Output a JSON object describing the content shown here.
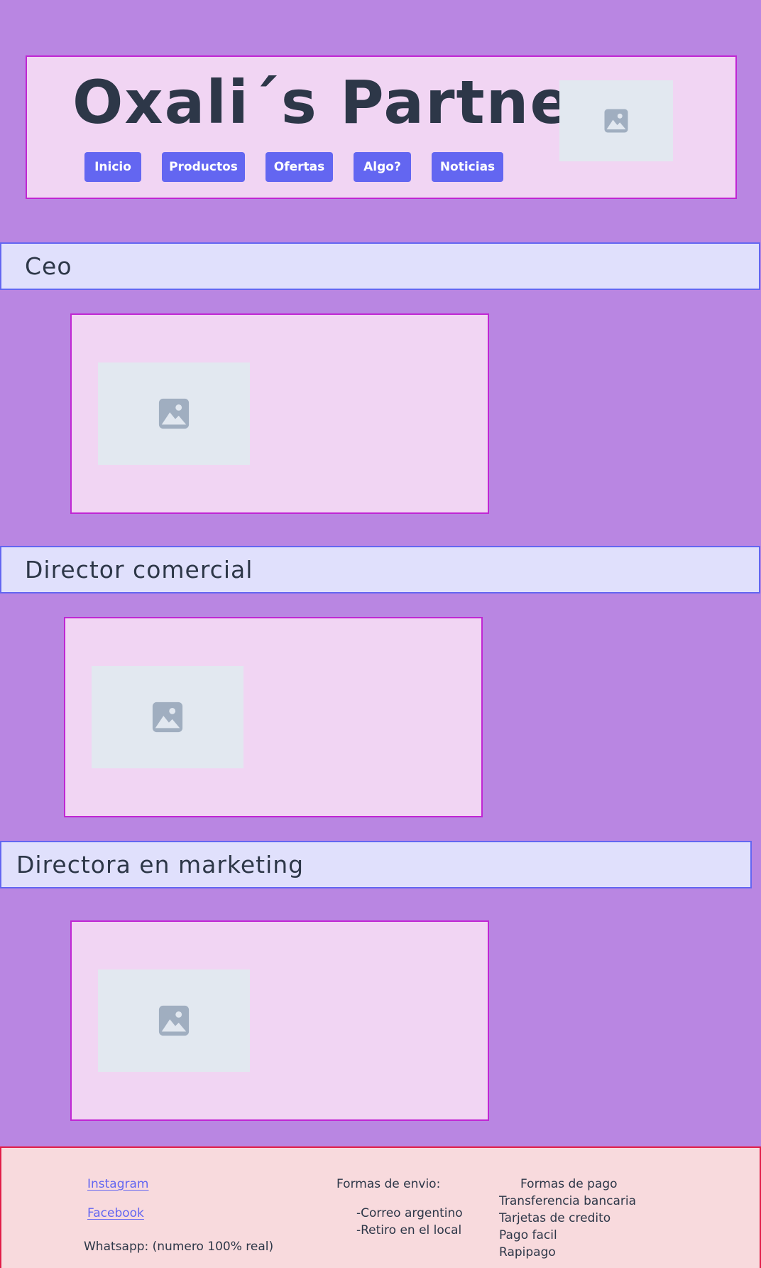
{
  "header": {
    "title": "Oxali´s Partners",
    "logo_icon": "image-placeholder-icon",
    "nav": [
      {
        "label": "Inicio"
      },
      {
        "label": "Productos"
      },
      {
        "label": "Ofertas"
      },
      {
        "label": "Algo?"
      },
      {
        "label": "Noticias"
      }
    ]
  },
  "sections": [
    {
      "title": "Ceo",
      "image_icon": "image-placeholder-icon"
    },
    {
      "title": "Director comercial",
      "image_icon": "image-placeholder-icon"
    },
    {
      "title": "Directora en marketing",
      "image_icon": "image-placeholder-icon"
    }
  ],
  "footer": {
    "social": {
      "instagram": "Instagram",
      "facebook": "Facebook",
      "whatsapp": "Whatsapp: (numero 100% real)"
    },
    "shipping": {
      "title": "Formas de envio:",
      "items": [
        "-Correo argentino",
        "-Retiro en el local"
      ]
    },
    "payment": {
      "title": "Formas de pago",
      "items": [
        "Transferencia bancaria",
        "Tarjetas de credito",
        "Pago facil",
        "Rapipago"
      ]
    }
  },
  "colors": {
    "page_background": "#b986e2",
    "panel_background": "#f1d5f3",
    "panel_border": "#c026d3",
    "banner_background": "#e0e0fc",
    "accent": "#6366f1",
    "footer_background": "#f8dadd",
    "footer_border": "#e11d48",
    "text": "#2d3748"
  }
}
